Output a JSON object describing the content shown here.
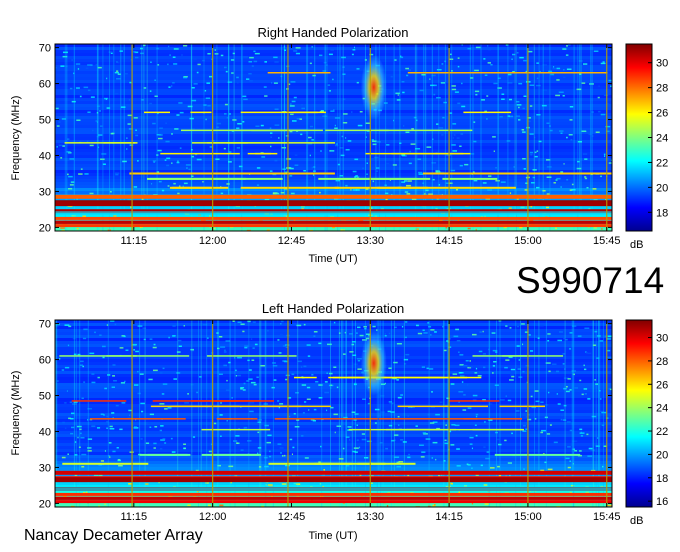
{
  "figure": {
    "date_code": "S990714",
    "footer": "Nancay Decameter Array"
  },
  "chart_data": [
    {
      "type": "heatmap",
      "title": "Right Handed Polarization",
      "xlabel": "Time (UT)",
      "ylabel": "Frequency (MHz)",
      "x_ticks": [
        "11:15",
        "12:00",
        "12:45",
        "13:30",
        "14:15",
        "15:00",
        "15:45"
      ],
      "x_tick_minutes": [
        675,
        720,
        765,
        810,
        855,
        900,
        945
      ],
      "xlim_minutes": [
        630,
        948
      ],
      "y_ticks": [
        20,
        30,
        40,
        50,
        60,
        70
      ],
      "ylim": [
        19,
        71
      ],
      "colorbar": {
        "label": "dB",
        "ticks": [
          18,
          20,
          22,
          24,
          26,
          28,
          30
        ],
        "range": [
          16.5,
          31.5
        ]
      },
      "features": {
        "bands_mhz": [
          20.5,
          21.5,
          22.5,
          24.5,
          26.5,
          27.0,
          28.5,
          31.0,
          33.5,
          35.0,
          40.5,
          43.5,
          47.0,
          52.0,
          63.0
        ],
        "burst": {
          "start_min": 808,
          "end_min": 816,
          "fmin_mhz": 50,
          "fmax_mhz": 68
        },
        "marker_minutes": [
          674,
          720,
          763,
          810,
          855,
          900,
          945
        ]
      }
    },
    {
      "type": "heatmap",
      "title": "Left Handed Polarization",
      "xlabel": "Time (UT)",
      "ylabel": "Frequency (MHz)",
      "x_ticks": [
        "11:15",
        "12:00",
        "12:45",
        "13:30",
        "14:15",
        "15:00",
        "15:45"
      ],
      "x_tick_minutes": [
        675,
        720,
        765,
        810,
        855,
        900,
        945
      ],
      "xlim_minutes": [
        630,
        948
      ],
      "y_ticks": [
        20,
        30,
        40,
        50,
        60,
        70
      ],
      "ylim": [
        19,
        71
      ],
      "colorbar": {
        "label": "dB",
        "ticks": [
          16,
          18,
          20,
          22,
          24,
          26,
          28,
          30
        ],
        "range": [
          15.5,
          31.5
        ]
      },
      "features": {
        "bands_mhz": [
          20.5,
          21.5,
          22.5,
          24.0,
          26.5,
          27.0,
          28.5,
          31.0,
          33.5,
          40.5,
          43.5,
          47.0,
          48.5,
          61.0,
          55.0
        ],
        "burst": {
          "start_min": 808,
          "end_min": 816,
          "fmin_mhz": 50,
          "fmax_mhz": 68
        },
        "marker_minutes": [
          674,
          720,
          763,
          810,
          855,
          900,
          945
        ]
      }
    }
  ]
}
